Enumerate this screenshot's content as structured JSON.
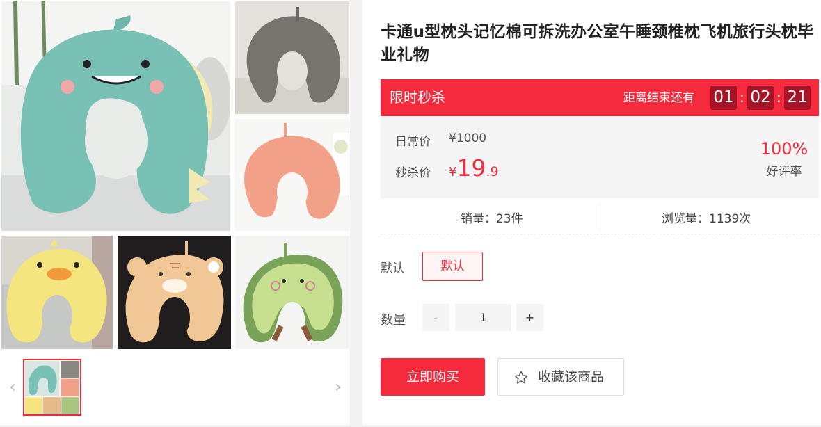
{
  "product": {
    "title": "卡通u型枕头记忆棉可拆洗办公室午睡颈椎枕飞机旅行头枕毕业礼物"
  },
  "gallery": {
    "images": [
      "dinosaur-pillow-image",
      "grey-pillow-image",
      "peach-pillow-image",
      "yellow-duck-pillow-image",
      "tiger-pillow-image",
      "avocado-pillow-image"
    ],
    "prev_arrow": "‹",
    "next_arrow": "›"
  },
  "flash_sale": {
    "label": "限时秒杀",
    "countdown_label": "距离结束还有",
    "hours": "01",
    "minutes": "02",
    "seconds": "21",
    "separator": ":"
  },
  "pricing": {
    "regular_label": "日常价",
    "regular_price": "¥1000",
    "flash_label": "秒杀价",
    "currency": "¥",
    "flash_int": "19",
    "flash_dec": ".9",
    "rating_pct": "100%",
    "rating_label": "好评率"
  },
  "stats": {
    "sales": "销量：23件",
    "views": "浏览量：1139次"
  },
  "options": {
    "label": "默认",
    "selected": "默认"
  },
  "quantity": {
    "label": "数量",
    "minus": "-",
    "value": "1",
    "plus": "+"
  },
  "actions": {
    "buy": "立即购买",
    "favorite": "收藏该商品",
    "favorite_icon": "star-icon"
  },
  "colors": {
    "accent": "#f52b3d",
    "countdown_bg": "#a61427",
    "price_box_bg": "#f5f5f5"
  }
}
